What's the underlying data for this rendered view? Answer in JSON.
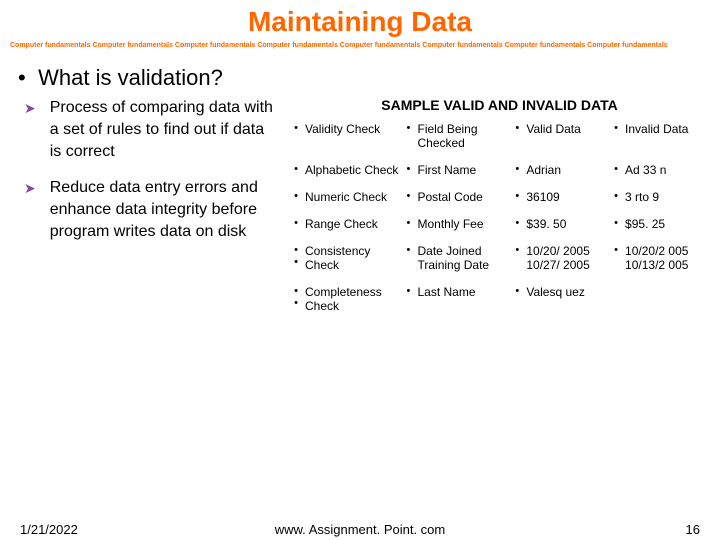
{
  "title": "Maintaining Data",
  "repeater": "Computer fundamentals Computer fundamentals Computer fundamentals Computer fundamentals Computer fundamentals Computer fundamentals Computer fundamentals Computer fundamentals",
  "heading_bullet": "•",
  "heading": "What is validation?",
  "items": [
    {
      "arrow": "➤",
      "text": "Process of comparing data with a set of rules to find out if data is correct"
    },
    {
      "arrow": "➤",
      "text": "Reduce data entry errors and enhance data integrity before program writes data on disk"
    }
  ],
  "sample_title": "SAMPLE VALID AND INVALID DATA",
  "table_rows": [
    {
      "c1": "Validity Check",
      "c2": "Field Being Checked",
      "c3": "Valid Data",
      "c4": "Invalid Data",
      "b1": "•",
      "b2": "•",
      "b3": "•",
      "b4": "•"
    },
    {
      "c1": "Alphabetic Check",
      "c2": "First Name",
      "c3": "Adrian",
      "c4": "Ad 33 n",
      "b1": "•",
      "b2": "•",
      "b3": "•",
      "b4": "•"
    },
    {
      "c1": "Numeric Check",
      "c2": "Postal Code",
      "c3": "36109",
      "c4": "3 rto 9",
      "b1": "•",
      "b2": "•",
      "b3": "•",
      "b4": "•"
    },
    {
      "c1": "Range Check",
      "c2": "Monthly Fee",
      "c3": "$39. 50",
      "c4": "$95. 25",
      "b1": "•",
      "b2": "•",
      "b3": "•",
      "b4": "•"
    },
    {
      "c1": "Consistency Check",
      "c2": "Date Joined Training Date",
      "c3": "10/20/ 2005 10/27/ 2005",
      "c4": "10/20/2 005 10/13/2 005",
      "b1": "•\n•",
      "b2": "•",
      "b3": "•",
      "b4": "•"
    },
    {
      "c1": "Completeness Check",
      "c2": "Last Name",
      "c3": "Valesq uez",
      "c4": "",
      "b1": "•\n•",
      "b2": "•",
      "b3": "•",
      "b4": ""
    }
  ],
  "footer": {
    "date": "1/21/2022",
    "center": "www. Assignment. Point. com",
    "page": "16"
  }
}
